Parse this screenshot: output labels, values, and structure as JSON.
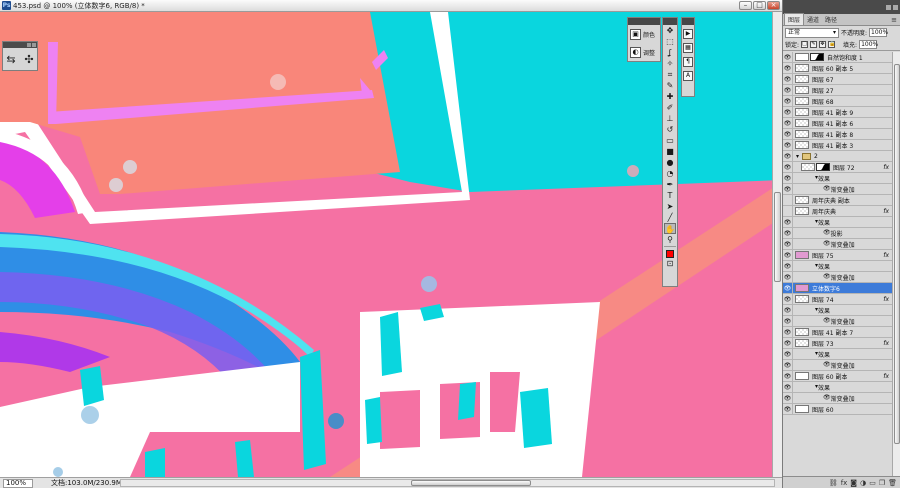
{
  "window": {
    "title": "453.psd @ 100% (立体数字6, RGB/8) *",
    "app_badge": "Ps",
    "min_label": "–",
    "max_label": "□",
    "close_label": "×"
  },
  "status": {
    "zoom": "100%",
    "doc_info": "文档:103.0M/230.9M",
    "arrow_left": "◂",
    "arrow_right": "▸"
  },
  "mini_panel": {
    "tools": [
      {
        "icon": "sliders-icon",
        "glyph": "⇆"
      },
      {
        "icon": "puppet-warp-icon",
        "glyph": "✣"
      }
    ]
  },
  "adjustments_panel": {
    "items": [
      {
        "label": "颜色",
        "icon": "color-icon",
        "glyph": "▣"
      },
      {
        "label": "调整",
        "icon": "adjust-icon",
        "glyph": "◐"
      }
    ]
  },
  "toolbar": {
    "tools": [
      {
        "name": "move",
        "glyph": "✥"
      },
      {
        "name": "marquee",
        "glyph": "⬚"
      },
      {
        "name": "lasso",
        "glyph": "ʆ"
      },
      {
        "name": "magic-wand",
        "glyph": "✧"
      },
      {
        "name": "crop",
        "glyph": "⌗"
      },
      {
        "name": "eyedropper",
        "glyph": "✎"
      },
      {
        "name": "healing",
        "glyph": "✚"
      },
      {
        "name": "brush",
        "glyph": "✐"
      },
      {
        "name": "stamp",
        "glyph": "⊥"
      },
      {
        "name": "history-brush",
        "glyph": "↺"
      },
      {
        "name": "eraser",
        "glyph": "▭"
      },
      {
        "name": "gradient",
        "glyph": "■"
      },
      {
        "name": "blur",
        "glyph": "●"
      },
      {
        "name": "dodge",
        "glyph": "◔"
      },
      {
        "name": "pen",
        "glyph": "✒"
      },
      {
        "name": "type",
        "glyph": "T"
      },
      {
        "name": "path-select",
        "glyph": "➤"
      },
      {
        "name": "shape",
        "glyph": "╱"
      },
      {
        "name": "hand",
        "glyph": "✋"
      },
      {
        "name": "zoom",
        "glyph": "⚲"
      }
    ],
    "active_tool": "hand",
    "foreground_color": "#ff0000",
    "mode_glyph": "⊡"
  },
  "side_panel": {
    "items": [
      {
        "icon": "history-icon",
        "glyph": "▶"
      },
      {
        "icon": "actions-icon",
        "glyph": "▦"
      },
      {
        "icon": "paragraph-icon",
        "glyph": "¶"
      },
      {
        "icon": "character-icon",
        "glyph": "A"
      }
    ]
  },
  "layers_panel": {
    "tabs": [
      {
        "label": "图层",
        "active": true
      },
      {
        "label": "通道",
        "active": false
      },
      {
        "label": "路径",
        "active": false
      }
    ],
    "menu_glyph": "≡",
    "blend_mode": "正常",
    "opacity_label": "不透明度:",
    "opacity_value": "100%",
    "lock_label": "锁定:",
    "fill_label": "填充:",
    "fill_value": "100%",
    "lock_glyphs": [
      "□",
      "✎",
      "✥",
      "🔒"
    ],
    "fx_label": "fx",
    "layers": [
      {
        "name": "自然饱和度 1",
        "kind": "adjustment",
        "visible": true
      },
      {
        "name": "图层 60 副本 5",
        "kind": "layer",
        "visible": true
      },
      {
        "name": "图层 67",
        "kind": "layer",
        "visible": true
      },
      {
        "name": "图层 27",
        "kind": "layer",
        "visible": true
      },
      {
        "name": "图层 68",
        "kind": "layer",
        "visible": true
      },
      {
        "name": "图层 41 副本 9",
        "kind": "layer",
        "visible": true
      },
      {
        "name": "图层 41 副本 6",
        "kind": "layer",
        "visible": true
      },
      {
        "name": "图层 41 副本 8",
        "kind": "layer",
        "visible": true
      },
      {
        "name": "图层 41 副本 3",
        "kind": "layer",
        "visible": true
      },
      {
        "name": "2",
        "kind": "group",
        "visible": true
      },
      {
        "name": "图层 72",
        "kind": "masked",
        "visible": true,
        "fx": true
      },
      {
        "name": "效果",
        "kind": "effect-head",
        "visible": true
      },
      {
        "name": "渐变叠加",
        "kind": "effect",
        "visible": true
      },
      {
        "name": "周年庆典 副本",
        "kind": "layer",
        "visible": false
      },
      {
        "name": "周年庆典",
        "kind": "layer",
        "visible": false,
        "fx": true
      },
      {
        "name": "效果",
        "kind": "effect-head",
        "visible": true
      },
      {
        "name": "投影",
        "kind": "effect",
        "visible": true
      },
      {
        "name": "渐变叠加",
        "kind": "effect",
        "visible": true
      },
      {
        "name": "图层 75",
        "kind": "pink",
        "visible": true,
        "fx": true
      },
      {
        "name": "效果",
        "kind": "effect-head",
        "visible": true
      },
      {
        "name": "渐变叠加",
        "kind": "effect",
        "visible": true
      },
      {
        "name": "立体数字6",
        "kind": "selected",
        "visible": true
      },
      {
        "name": "图层 74",
        "kind": "layer",
        "visible": true,
        "fx": true
      },
      {
        "name": "效果",
        "kind": "effect-head",
        "visible": true
      },
      {
        "name": "渐变叠加",
        "kind": "effect",
        "visible": true
      },
      {
        "name": "图层 41 副本 7",
        "kind": "layer",
        "visible": true
      },
      {
        "name": "图层 73",
        "kind": "layer",
        "visible": true,
        "fx": true
      },
      {
        "name": "效果",
        "kind": "effect-head",
        "visible": true
      },
      {
        "name": "渐变叠加",
        "kind": "effect",
        "visible": true
      },
      {
        "name": "图层 60 副本",
        "kind": "white",
        "visible": true,
        "fx": true
      },
      {
        "name": "效果",
        "kind": "effect-head",
        "visible": true
      },
      {
        "name": "渐变叠加",
        "kind": "effect",
        "visible": true
      },
      {
        "name": "图层 60",
        "kind": "white",
        "visible": true
      }
    ],
    "bottom_icons": [
      {
        "icon": "link-icon",
        "glyph": "⛓"
      },
      {
        "icon": "fx-icon",
        "glyph": "fx"
      },
      {
        "icon": "mask-icon",
        "glyph": "◙"
      },
      {
        "icon": "adjustment-icon",
        "glyph": "◑"
      },
      {
        "icon": "folder-icon",
        "glyph": "▭"
      },
      {
        "icon": "new-layer-icon",
        "glyph": "❐"
      },
      {
        "icon": "trash-icon",
        "glyph": "🗑"
      }
    ]
  },
  "colors": {
    "canvas_pink": "#f571a3",
    "canvas_cyan": "#0ad6de",
    "canvas_salmon": "#f9867a",
    "canvas_magenta": "#e43fe9",
    "canvas_blue": "#2f8ee6",
    "selection_blue": "#3d7bd9"
  }
}
